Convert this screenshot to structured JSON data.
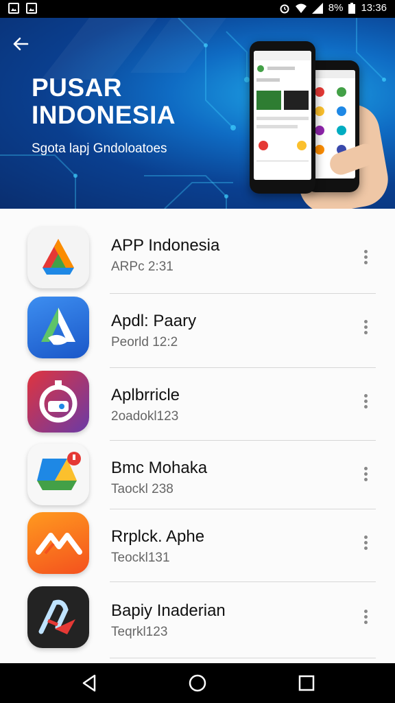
{
  "status_bar": {
    "time": "13:36",
    "battery": "8%"
  },
  "banner": {
    "title_line1": "PUSAR",
    "title_line2": "INDONESIA",
    "subtitle": "Sgota lapj Gndoloatoes"
  },
  "apps": [
    {
      "name": "APP Indonesia",
      "subtitle": "ARPc 2:31",
      "icon": "triangle-drive-icon"
    },
    {
      "name": "Apdl: Paary",
      "subtitle": "Peorld 12:2",
      "icon": "blue-a-icon"
    },
    {
      "name": "Aplbrricle",
      "subtitle": "2oadokl123",
      "icon": "chat-badge-icon"
    },
    {
      "name": "Bmc Mohaka",
      "subtitle": "Taockl 238",
      "icon": "drive-notification-icon"
    },
    {
      "name": "Rrplck. Aphe",
      "subtitle": "Teockl131",
      "icon": "orange-m-icon"
    },
    {
      "name": "Bapiy Inaderian",
      "subtitle": "Teqrkl123",
      "icon": "dark-arrow-icon"
    }
  ],
  "colors": {
    "banner": "#0a3f8f",
    "accent": "#1fa6e6",
    "statusbar": "#000000"
  }
}
